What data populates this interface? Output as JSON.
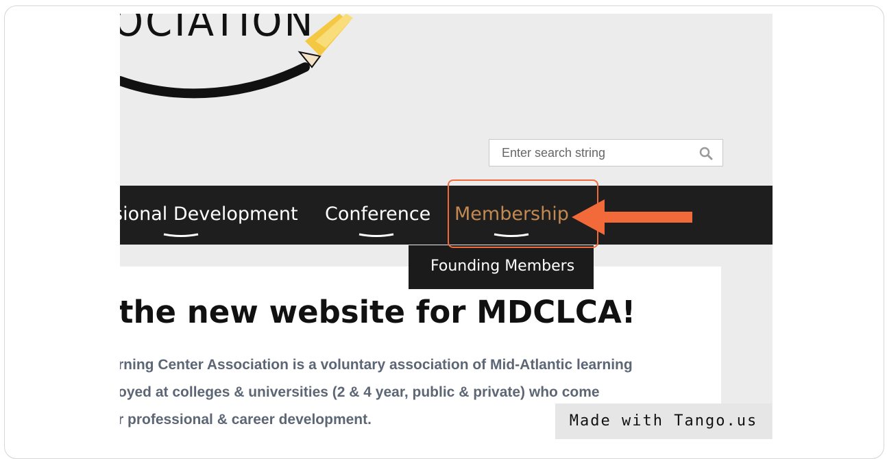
{
  "header": {
    "logo_text": "OCIATION"
  },
  "search": {
    "placeholder": "Enter search string",
    "icon": "search-icon"
  },
  "nav": {
    "items": [
      {
        "label": "sional Development"
      },
      {
        "label": "Conference"
      },
      {
        "label": "Membership"
      }
    ],
    "active_color": "#c28a52",
    "bar_color": "#1e1e1e"
  },
  "dropdown": {
    "items": [
      {
        "label": "Founding Members"
      }
    ]
  },
  "content": {
    "headline": "the new website for MDCLCA!",
    "lines": [
      "rning Center Association is a voluntary association of Mid-Atlantic learning",
      "oyed at colleges & universities (2 & 4 year, public & private) who come",
      "r professional & career development."
    ]
  },
  "annotation": {
    "highlight_color": "#f26a3a"
  },
  "watermark": {
    "text": "Made with Tango.us"
  }
}
